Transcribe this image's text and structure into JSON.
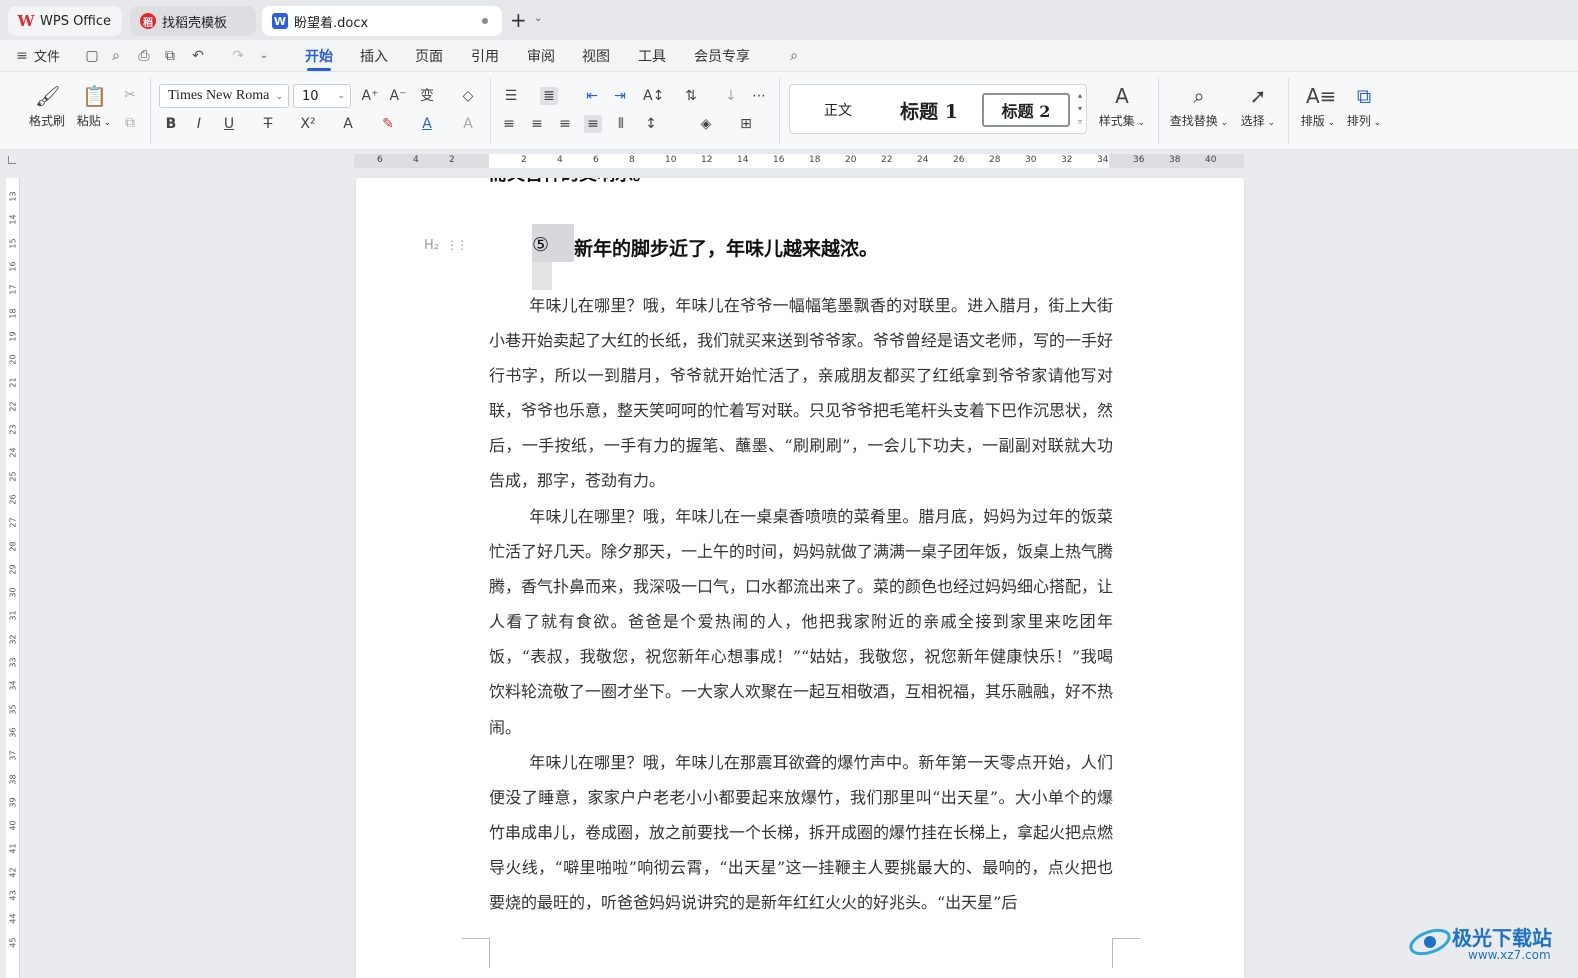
{
  "tabs": [
    {
      "label": "WPS Office"
    },
    {
      "label": "找稻壳模板"
    },
    {
      "label": "盼望着.docx"
    }
  ],
  "menu": {
    "file": "文件",
    "items": [
      "开始",
      "插入",
      "页面",
      "引用",
      "审阅",
      "视图",
      "工具",
      "会员专享"
    ],
    "active": "开始"
  },
  "ribbon": {
    "format_painter": "格式刷",
    "paste": "粘贴",
    "font_name": "Times New Roma",
    "font_size": "10",
    "styles": {
      "body": "正文",
      "h1": "标题 1",
      "h2": "标题 2"
    },
    "style_set": "样式集",
    "find_replace": "查找替换",
    "select": "选择",
    "layout": "排版",
    "arrange": "排列"
  },
  "ruler": {
    "h_ticks": [
      "6",
      "4",
      "2",
      "",
      "2",
      "4",
      "6",
      "8",
      "10",
      "12",
      "14",
      "16",
      "18",
      "20",
      "22",
      "24",
      "26",
      "28",
      "30",
      "32",
      "34",
      "36",
      "38",
      "40"
    ],
    "v_ticks": [
      "13",
      "14",
      "15",
      "16",
      "17",
      "18",
      "19",
      "20",
      "21",
      "22",
      "23",
      "24",
      "25",
      "26",
      "27",
      "28",
      "29",
      "30",
      "31",
      "32",
      "33",
      "34",
      "35",
      "36",
      "37",
      "38",
      "39",
      "40",
      "41",
      "42",
      "43",
      "44",
      "45"
    ]
  },
  "document": {
    "cut_line": "而又吉祥的交响乐。",
    "heading_marker": "H₂",
    "heading_num": "⑤",
    "heading": "新年的脚步近了，年味儿越来越浓。",
    "paragraphs": [
      "年味儿在哪里？哦，年味儿在爷爷一幅幅笔墨飘香的对联里。进入腊月，街上大街小巷开始卖起了大红的长纸，我们就买来送到爷爷家。爷爷曾经是语文老师，写的一手好行书字，所以一到腊月，爷爷就开始忙活了，亲戚朋友都买了红纸拿到爷爷家请他写对联，爷爷也乐意，整天笑呵呵的忙着写对联。只见爷爷把毛笔杆头支着下巴作沉思状，然后，一手按纸，一手有力的握笔、蘸墨、“刷刷刷”，一会儿下功夫，一副副对联就大功告成，那字，苍劲有力。",
      "年味儿在哪里？哦，年味儿在一桌桌香喷喷的菜肴里。腊月底，妈妈为过年的饭菜忙活了好几天。除夕那天，一上午的时间，妈妈就做了满满一桌子团年饭，饭桌上热气腾腾，香气扑鼻而来，我深吸一口气，口水都流出来了。菜的颜色也经过妈妈细心搭配，让人看了就有食欲。爸爸是个爱热闹的人，他把我家附近的亲戚全接到家里来吃团年饭，“表叔，我敬您，祝您新年心想事成！”“姑姑，我敬您，祝您新年健康快乐！”我喝饮料轮流敬了一圈才坐下。一大家人欢聚在一起互相敬酒，互相祝福，其乐融融，好不热闹。",
      "年味儿在哪里？哦，年味儿在那震耳欲聋的爆竹声中。新年第一天零点开始，人们便没了睡意，家家户户老老小小都要起来放爆竹，我们那里叫“出天星”。大小单个的爆竹串成串儿，卷成圈，放之前要找一个长梯，拆开成圈的爆竹挂在长梯上，拿起火把点燃导火线，“噼里啪啦”响彻云霄，“出天星”这一挂鞭主人要挑最大的、最响的，点火把也要烧的最旺的，听爸爸妈妈说讲究的是新年红红火火的好兆头。“出天星”后"
    ]
  },
  "watermark": {
    "title": "极光下载站",
    "url": "www.xz7.com"
  },
  "colors": {
    "accent": "#2b5ce6",
    "wps_red": "#e3262d",
    "watermark": "#1e72c5"
  }
}
